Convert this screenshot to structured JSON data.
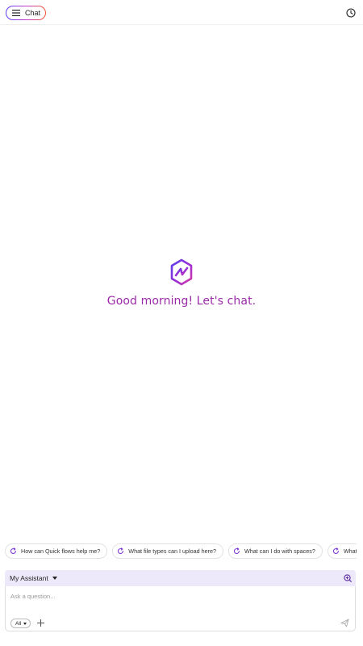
{
  "header": {
    "menu_button_label": "Chat",
    "history_icon": "clock-icon"
  },
  "hero": {
    "logo_icon": "hexagon-bolt-logo",
    "greeting": "Good morning! Let's chat."
  },
  "suggestions": [
    {
      "label": "How can Quick flows help me?"
    },
    {
      "label": "What file types can I upload here?"
    },
    {
      "label": "What can I do with spaces?"
    },
    {
      "label": "What can Qu"
    }
  ],
  "composer": {
    "assistant_label": "My Assistant",
    "placeholder": "Ask a question...",
    "filter_value": "All"
  },
  "colors": {
    "accent": "#9a2aa8",
    "assistant_bar": "#ede9fb",
    "gradient": [
      "#5b3cf0",
      "#c53cc8",
      "#f05a28"
    ]
  }
}
